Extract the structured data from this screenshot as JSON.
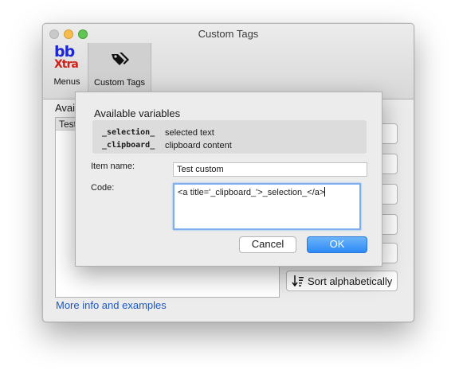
{
  "window": {
    "title": "Custom Tags"
  },
  "toolbar": {
    "menus": {
      "logo_top": "bb",
      "logo_bottom": "Xtra",
      "label": "Menus"
    },
    "custom_tags": {
      "label": "Custom Tags",
      "icon": "tag-icon"
    }
  },
  "main": {
    "available_label": "Avail",
    "list_header": "Test",
    "sort_button": {
      "label": "Sort alphabetically",
      "icon": "sort-icon"
    },
    "more_info_link": "More info and examples"
  },
  "dialog": {
    "heading": "Available variables",
    "variables": [
      {
        "name": "_selection_",
        "description": "selected text"
      },
      {
        "name": "_clipboard_",
        "description": "clipboard content"
      }
    ],
    "item_name_label": "Item name:",
    "item_name_value": "Test custom",
    "code_label": "Code:",
    "code_value": "<a title='_clipboard_'>_selection_</a>",
    "cancel_label": "Cancel",
    "ok_label": "OK"
  },
  "colors": {
    "link": "#1b58c4",
    "ok_button": "#2d8af6",
    "logo_blue": "#1d27d8",
    "logo_red": "#d0201a",
    "focus_ring": "#7eaef0"
  }
}
